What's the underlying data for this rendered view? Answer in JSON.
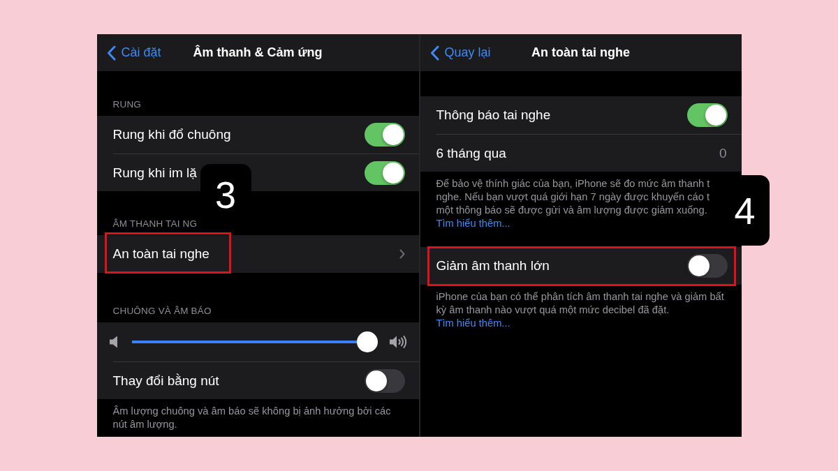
{
  "screens": [
    {
      "nav_bar": {
        "back": "Cài đặt",
        "title": "Âm thanh & Cảm ứng"
      },
      "step_badge": "3",
      "sections": [
        {
          "header": "RUNG",
          "rows": [
            {
              "kind": "toggle",
              "label": "Rung khi đổ chuông",
              "on": true,
              "highlighted": false
            },
            {
              "kind": "toggle",
              "label": "Rung khi im lặ",
              "on": true,
              "highlighted": false
            }
          ]
        },
        {
          "header": "ÂM THANH TAI NG",
          "rows": [
            {
              "kind": "link",
              "label": "An toàn tai nghe",
              "highlighted": true
            }
          ]
        },
        {
          "header": "CHUÔNG VÀ ÂM BÁO",
          "rows": [
            {
              "kind": "slider",
              "level": 1,
              "highlighted": false
            },
            {
              "kind": "toggle",
              "label": "Thay đổi bằng nút",
              "on": false,
              "highlighted": false
            }
          ],
          "footer": {
            "text": "Âm lượng chuông và âm báo sẽ không bị ảnh hưởng bởi các nút âm lượng."
          }
        }
      ]
    },
    {
      "nav_bar": {
        "back": "Quay lại",
        "title": "An toàn tai nghe"
      },
      "step_badge": "4",
      "sections": [
        {
          "rows": [
            {
              "kind": "toggle",
              "label": "Thông báo tai nghe",
              "on": true,
              "highlighted": false
            },
            {
              "kind": "value",
              "label": "6 tháng qua",
              "value": "0",
              "highlighted": false
            }
          ],
          "footer": {
            "text": "Để bảo vệ thính giác của bạn, iPhone sẽ đo mức âm thanh t\nnghe. Nếu bạn vượt quá giới hạn 7 ngày được khuyến cáo t\nmột thông báo sẽ được gửi và âm lượng được giảm xuống.",
            "link": "Tìm hiểu thêm..."
          }
        },
        {
          "rows": [
            {
              "kind": "toggle",
              "label": "Giảm âm thanh lớn",
              "on": false,
              "highlighted": true
            }
          ],
          "footer": {
            "text": "iPhone của bạn có thể phân tích âm thanh tai nghe và giảm bất kỳ âm thanh nào vượt quá một mức decibel đã đặt.",
            "link": "Tìm hiểu thêm..."
          }
        }
      ]
    }
  ]
}
